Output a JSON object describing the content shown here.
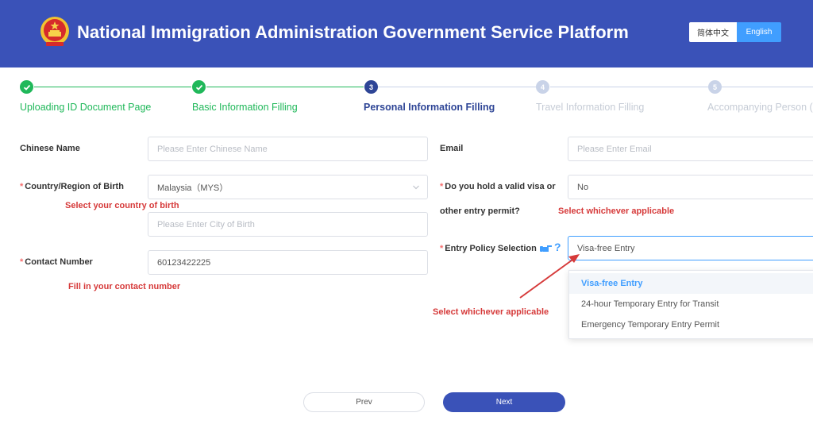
{
  "header": {
    "title": "National Immigration Administration Government Service Platform",
    "emblem_icon": "national-emblem-icon",
    "lang_zh": "简体中文",
    "lang_en": "English"
  },
  "steps": [
    {
      "number": "1",
      "label": "Uploading ID Document Page",
      "status": "done"
    },
    {
      "number": "2",
      "label": "Basic Information Filling",
      "status": "done"
    },
    {
      "number": "3",
      "label": "Personal Information Filling",
      "status": "active"
    },
    {
      "number": "4",
      "label": "Travel Information Filling",
      "status": "pending"
    },
    {
      "number": "5",
      "label": "Accompanying Person (s",
      "status": "pending"
    }
  ],
  "form": {
    "chinese_name": {
      "label": "Chinese Name",
      "placeholder": "Please Enter Chinese Name"
    },
    "country_birth": {
      "required": "*",
      "label": "Country/Region of Birth",
      "value": "Malaysia（MYS）",
      "hint": "Select your country of birth"
    },
    "city_birth": {
      "placeholder": "Please Enter City of Birth"
    },
    "contact": {
      "required": "*",
      "label": "Contact Number",
      "value": "60123422225",
      "hint": "Fill in your contact number"
    },
    "email": {
      "label": "Email",
      "placeholder": "Please Enter Email"
    },
    "visa": {
      "required": "*",
      "label_line1": "Do you hold a valid visa or",
      "label_line2": "other entry permit?",
      "value": "No",
      "hint": "Select whichever applicable"
    },
    "entry_policy": {
      "required": "*",
      "label": "Entry Policy Selection",
      "help_icons": [
        "pointing-hand-icon",
        "question-icon"
      ],
      "help_mark": "?",
      "value": "Visa-free Entry",
      "options": [
        "Visa-free Entry",
        "24-hour Temporary Entry for Transit",
        "Emergency Temporary Entry Permit"
      ],
      "annotation": "Select whichever applicable"
    }
  },
  "buttons": {
    "prev": "Prev",
    "next": "Next"
  },
  "colors": {
    "header": "#3a52b8",
    "done": "#20b85a",
    "active": "#2e4596",
    "hint": "#d63a3a",
    "accent": "#409eff"
  }
}
